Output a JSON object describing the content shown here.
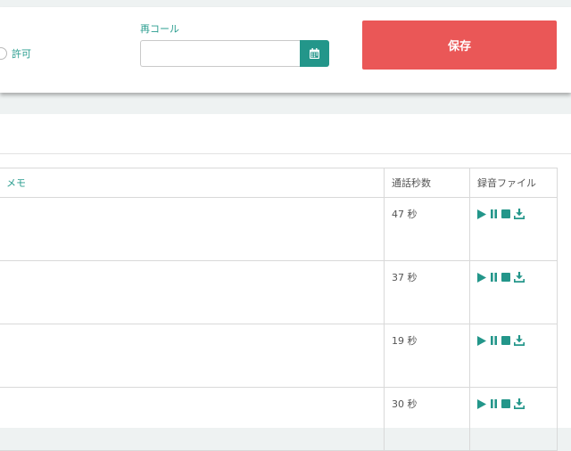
{
  "form": {
    "permit_label": "許可",
    "recall_label": "再コール",
    "recall_value": "",
    "save_label": "保存"
  },
  "table": {
    "headers": {
      "memo": "メモ",
      "duration": "通話秒数",
      "file": "録音ファイル"
    },
    "rows": [
      {
        "memo": "",
        "duration": "47 秒"
      },
      {
        "memo": "",
        "duration": "37 秒"
      },
      {
        "memo": "",
        "duration": "19 秒"
      },
      {
        "memo": "",
        "duration": "30 秒"
      }
    ]
  },
  "icons": {
    "calendar": "calendar-icon",
    "play": "play-icon",
    "pause": "pause-icon",
    "stop": "stop-icon",
    "download": "download-icon"
  },
  "colors": {
    "accent": "#23968a",
    "save": "#ea5757",
    "label": "#2a9d8f"
  }
}
